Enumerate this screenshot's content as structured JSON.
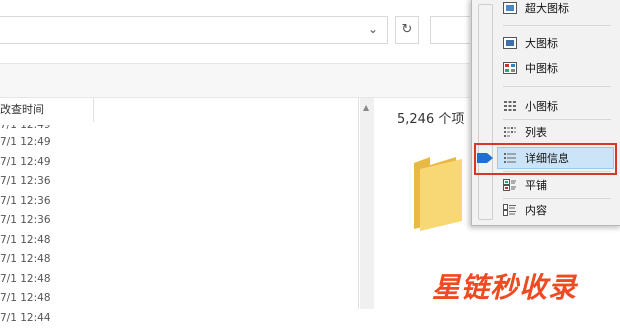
{
  "column_header": "改查时间",
  "rows": [
    "7/1 12:49",
    "7/1 12:49",
    "7/1 12:36",
    "7/1 12:36",
    "7/1 12:36",
    "7/1 12:48",
    "7/1 12:48",
    "7/1 12:48",
    "7/1 12:48",
    "7/1 12:44"
  ],
  "item_count": "5,246 个项",
  "menu": {
    "items": [
      {
        "label": "超大图标",
        "icon": "extra-large-icons-icon"
      },
      {
        "label": "大图标",
        "icon": "large-icons-icon"
      },
      {
        "label": "中图标",
        "icon": "medium-icons-icon"
      },
      {
        "label": "小图标",
        "icon": "small-icons-icon"
      },
      {
        "label": "列表",
        "icon": "list-icon"
      },
      {
        "label": "详细信息",
        "icon": "details-icon"
      },
      {
        "label": "平铺",
        "icon": "tiles-icon"
      },
      {
        "label": "内容",
        "icon": "content-icon"
      }
    ],
    "selected": "详细信息"
  },
  "watermark": "星链秒收录",
  "colors": {
    "highlight": "#cce4f7",
    "annotation_box": "#d9362b",
    "watermark": "#ef4a22",
    "folder": "#f8d775",
    "pointer": "#1e6fd0"
  }
}
